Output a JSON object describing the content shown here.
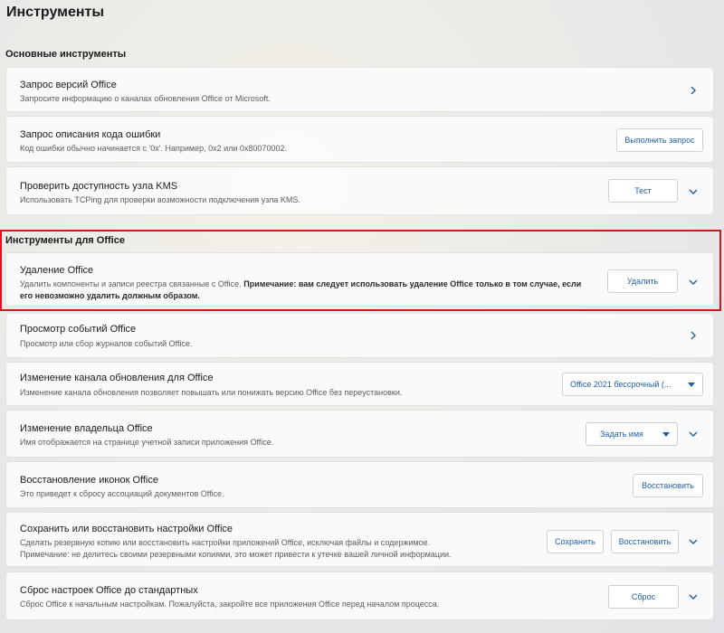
{
  "page": {
    "title": "Инструменты"
  },
  "sections": {
    "basic": "Основные инструменты",
    "office": "Инструменты для Office"
  },
  "cards": {
    "versions": {
      "title": "Запрос версий Office",
      "desc": "Запросите информацию о каналах обновления Office от Microsoft."
    },
    "error_code": {
      "title": "Запрос описания кода ошибки",
      "desc": "Код ошибки обычно начинается с '0x'. Например, 0x2 или 0x80070002.",
      "button": "Выполнить запрос"
    },
    "kms": {
      "title": "Проверить доступность узла KMS",
      "desc": "Использовать TCPing для проверки возможности подключения узла KMS.",
      "button": "Тест"
    },
    "remove": {
      "title": "Удаление Office",
      "desc_plain": "Удалить компоненты и записи реестра связанные с Office. ",
      "desc_bold_1": "Примечание: вам следует использовать удаление Office только в том случае, если",
      "desc_bold_2": "его невозможно удалить должным образом.",
      "button": "Удалить"
    },
    "events": {
      "title": "Просмотр событий Office",
      "desc": "Просмотр или сбор журналов событий Office."
    },
    "channel": {
      "title": "Изменение канала обновления для Office",
      "desc": "Изменение канала обновления позволяет повышать или понижать версию Office без переустановки.",
      "dropdown": "Office 2021 бессрочный (..."
    },
    "owner": {
      "title": "Изменение владельца Office",
      "desc": "Имя отображается на странице учетной записи приложения Office.",
      "dropdown": "Задать имя"
    },
    "icons": {
      "title": "Восстановление иконок Office",
      "desc": "Это приведет к сбросу ассоциаций документов Office.",
      "button": "Восстановить"
    },
    "backup": {
      "title": "Сохранить или восстановить настройки Office",
      "desc_1": "Сделать резервную копию или восстановить настройки приложений Office, исключая файлы и содержимое.",
      "desc_2": "Примечание: не делитесь своими резервными копиями, это может привести к утечке вашей личной информации.",
      "button_save": "Сохранить",
      "button_restore": "Восстановить"
    },
    "reset": {
      "title": "Сброс настроек Office до стандартных",
      "desc": "Сброс Office к начальным настройкам. Пожалуйста, закройте все приложения Office перед началом процесса.",
      "button": "Сброс"
    }
  },
  "colors": {
    "accent": "#1f5fa8",
    "highlight": "#e0101c"
  },
  "icons": {
    "expand": "chevron-down-icon",
    "navigate": "chevron-right-icon"
  }
}
